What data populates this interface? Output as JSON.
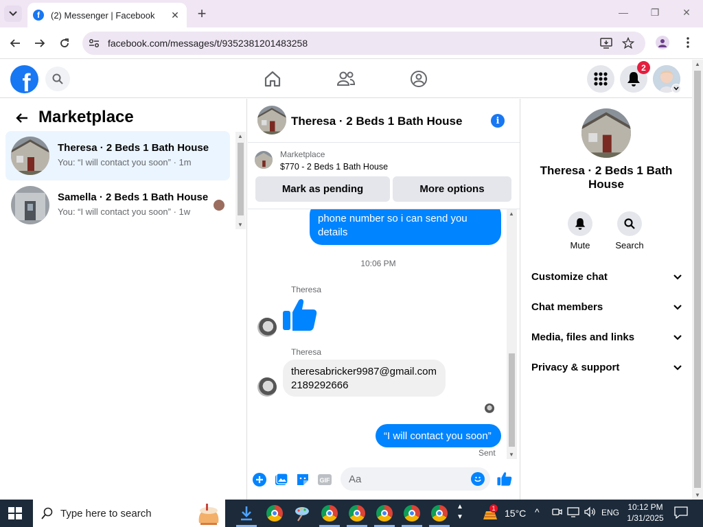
{
  "browser": {
    "tab_title": "(2) Messenger | Facebook",
    "url": "facebook.com/messages/t/9352381201483258"
  },
  "fb_nav": {
    "notification_count": "2"
  },
  "left": {
    "title": "Marketplace",
    "conversations": [
      {
        "name": "Theresa · 2 Beds 1 Bath House",
        "preview": "You: “I will contact you soon” · 1m",
        "active": true
      },
      {
        "name": "Samella · 2 Beds 1 Bath House",
        "preview": "You: “I will contact you soon” · 1w",
        "active": false
      }
    ]
  },
  "chat": {
    "header_name": "Theresa · 2 Beds 1 Bath House",
    "listing_source": "Marketplace",
    "listing_price": "$770 - 2 Beds 1 Bath House",
    "mark_pending_label": "Mark as pending",
    "more_options_label": "More options",
    "messages": {
      "m1": "phone number so i can send you details",
      "timestamp": "10:06 PM",
      "sender1": "Theresa",
      "sender2": "Theresa",
      "m3_line1": "theresabricker9987@gmail.com",
      "m3_line2": "2189292666",
      "m4": "“I will contact you soon”",
      "status": "Sent"
    },
    "composer_placeholder": "Aa"
  },
  "right": {
    "name": "Theresa · 2 Beds 1 Bath House",
    "mute_label": "Mute",
    "search_label": "Search",
    "sections": [
      "Customize chat",
      "Chat members",
      "Media, files and links",
      "Privacy & support"
    ]
  },
  "taskbar": {
    "search_placeholder": "Type here to search",
    "temperature": "15°C",
    "language": "ENG",
    "time": "10:12 PM",
    "date": "1/31/2025",
    "weather_badge": "1"
  },
  "colors": {
    "fb_blue": "#1877f2",
    "messenger_blue": "#0084ff",
    "active_row": "#ebf5ff",
    "taskbar": "#1c2a3a"
  },
  "icons": [
    "tab-list-icon",
    "facebook-favicon",
    "close-tab-icon",
    "new-tab-icon",
    "minimize-icon",
    "maximize-icon",
    "close-window-icon",
    "back-icon",
    "forward-icon",
    "reload-icon",
    "site-info-icon",
    "install-app-icon",
    "bookmark-star-icon",
    "profile-icon",
    "menu-kebab-icon",
    "facebook-logo",
    "search-icon",
    "home-icon",
    "friends-icon",
    "groups-icon",
    "menu-grid-icon",
    "notifications-bell-icon",
    "info-icon",
    "thumbs-up-icon",
    "plus-icon",
    "image-icon",
    "sticker-icon",
    "gif-icon",
    "emoji-icon",
    "mute-bell-icon",
    "chevron-down-icon",
    "windows-start-icon",
    "chrome-icon"
  ]
}
